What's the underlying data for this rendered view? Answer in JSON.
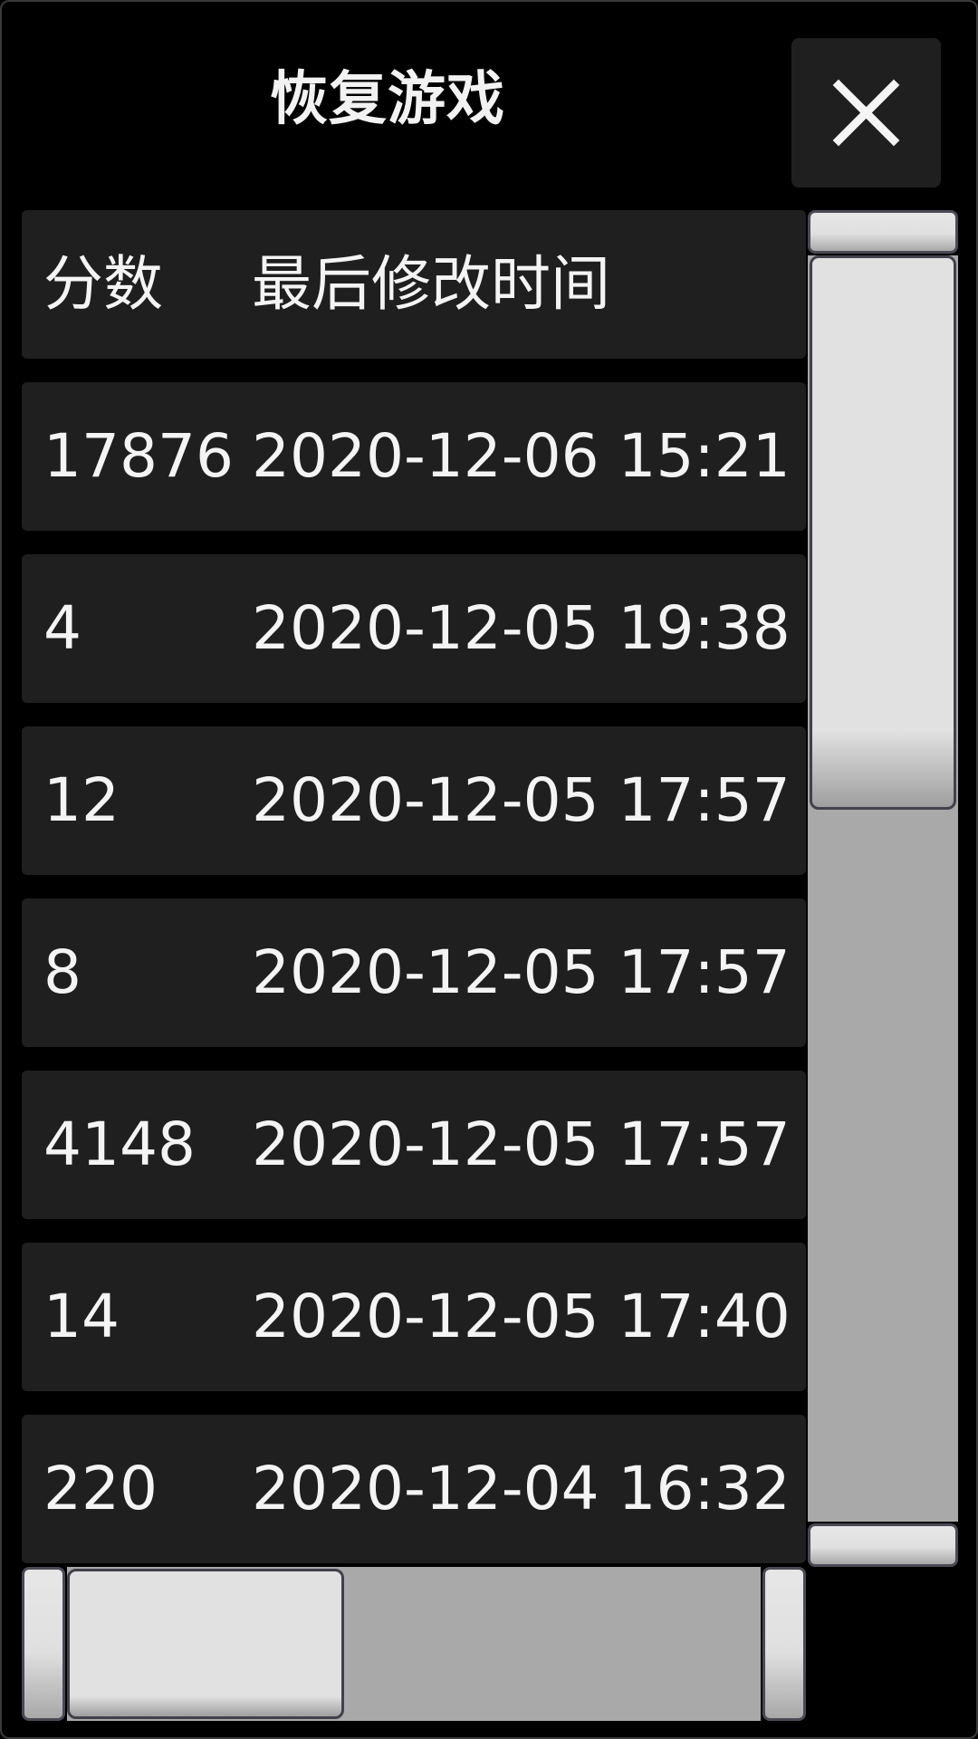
{
  "dialog": {
    "title": "恢复游戏",
    "close_icon": "close-icon"
  },
  "table": {
    "headers": {
      "score": "分数",
      "time": "最后修改时间"
    },
    "rows": [
      {
        "score": "17876",
        "time": "2020-12-06 15:21"
      },
      {
        "score": "4",
        "time": "2020-12-05 19:38"
      },
      {
        "score": "12",
        "time": "2020-12-05 17:57"
      },
      {
        "score": "8",
        "time": "2020-12-05 17:57"
      },
      {
        "score": "4148",
        "time": "2020-12-05 17:57"
      },
      {
        "score": "14",
        "time": "2020-12-05 17:40"
      },
      {
        "score": "220",
        "time": "2020-12-04 16:32"
      }
    ]
  },
  "scrollbars": {
    "vertical_position": 0.0,
    "vertical_visible_fraction": 0.43,
    "horizontal_position": 0.0,
    "horizontal_visible_fraction": 0.4
  },
  "colors": {
    "background": "#000000",
    "row_background": "#1f1f1f",
    "text": "#f4f4f4",
    "scroll_track": "#a9a9a9",
    "scroll_thumb": "#e1e1e1"
  }
}
